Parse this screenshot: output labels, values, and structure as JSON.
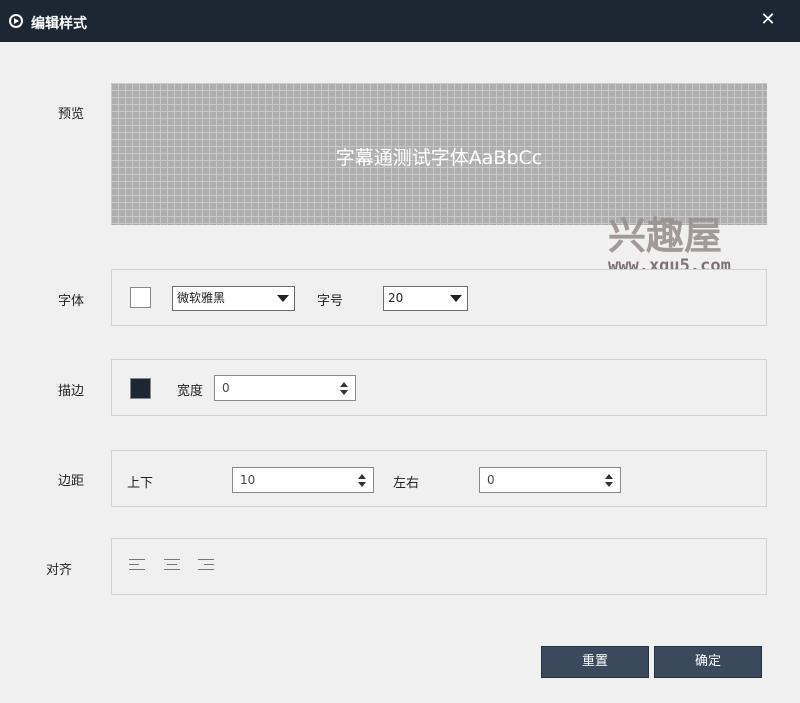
{
  "window": {
    "title": "编辑样式",
    "close_icon": "✕"
  },
  "preview": {
    "label": "预览",
    "sample_text": "字幕通测试字体AaBbCc"
  },
  "watermark": {
    "big": "兴趣屋",
    "url": "www.xqu5.com"
  },
  "font": {
    "label": "字体",
    "color_swatch": "#ffffff",
    "family_value": "微软雅黑",
    "size_label": "字号",
    "size_value": "20"
  },
  "stroke": {
    "label": "描边",
    "color_swatch": "#1c2733",
    "width_label": "宽度",
    "width_value": "0"
  },
  "margin": {
    "label": "边距",
    "vertical_label": "上下",
    "vertical_value": "10",
    "horizontal_label": "左右",
    "horizontal_value": "0"
  },
  "align": {
    "label": "对齐",
    "options": [
      "align-left-icon",
      "align-center-icon",
      "align-right-icon"
    ]
  },
  "buttons": {
    "reset": "重置",
    "confirm": "确定"
  }
}
